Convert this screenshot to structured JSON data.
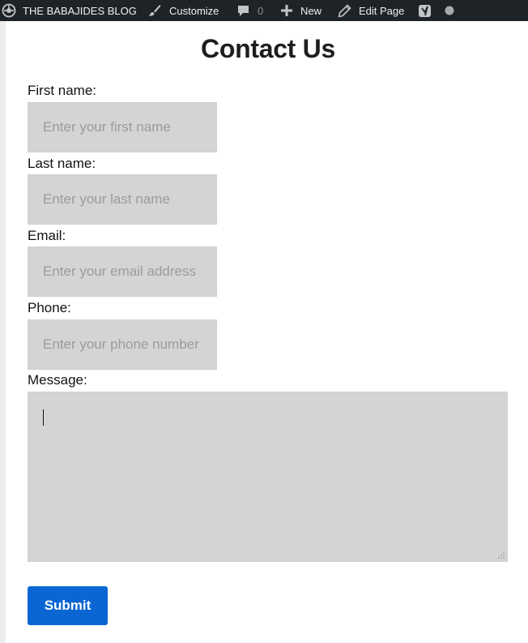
{
  "admin_bar": {
    "site_name": "THE BABAJIDES BLOG",
    "customize_label": "Customize",
    "comments_count": "0",
    "new_label": "New",
    "edit_page_label": "Edit Page",
    "icons": [
      "dashboard-icon",
      "brush-icon",
      "comment-icon",
      "plus-icon",
      "pencil-icon",
      "yoast-icon",
      "status-dot-icon"
    ]
  },
  "page": {
    "title": "Contact Us"
  },
  "form": {
    "first_name": {
      "label": "First name:",
      "placeholder": "Enter your first name",
      "value": ""
    },
    "last_name": {
      "label": "Last name:",
      "placeholder": "Enter your last name",
      "value": ""
    },
    "email": {
      "label": "Email:",
      "placeholder": "Enter your email address",
      "value": ""
    },
    "phone": {
      "label": "Phone:",
      "placeholder": "Enter your phone number",
      "value": ""
    },
    "message": {
      "label": "Message:",
      "value": ""
    },
    "submit_label": "Submit"
  },
  "colors": {
    "admin_bar_bg": "#1d2327",
    "field_bg": "#d5d4d3",
    "submit_bg": "#0a66d3"
  }
}
